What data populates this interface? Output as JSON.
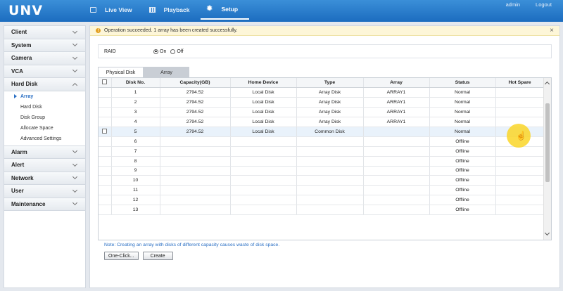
{
  "app": {
    "logo": "UNV",
    "nav": [
      {
        "label": "Live View",
        "icon": "monitor-icon",
        "active": false
      },
      {
        "label": "Playback",
        "icon": "film-icon",
        "active": false
      },
      {
        "label": "Setup",
        "icon": "gear-icon",
        "active": true
      }
    ],
    "user": "admin",
    "logout": "Logout"
  },
  "sidebar": {
    "sections": [
      {
        "label": "Client"
      },
      {
        "label": "System"
      },
      {
        "label": "Camera"
      },
      {
        "label": "VCA"
      },
      {
        "label": "Hard Disk",
        "expanded": true,
        "items": [
          "Array",
          "Hard Disk",
          "Disk Group",
          "Allocate Space",
          "Advanced Settings"
        ],
        "active_item": "Array"
      },
      {
        "label": "Alarm"
      },
      {
        "label": "Alert"
      },
      {
        "label": "Network"
      },
      {
        "label": "User"
      },
      {
        "label": "Maintenance"
      }
    ]
  },
  "banner": {
    "message": "Operation succeeded. 1 array has been created successfully.",
    "close": "×"
  },
  "raid": {
    "label": "RAID",
    "on": "On",
    "off": "Off",
    "selected": "On"
  },
  "tabs": [
    {
      "label": "Physical Disk",
      "active": true
    },
    {
      "label": "Array",
      "active": false
    }
  ],
  "table": {
    "headers": [
      "",
      "Disk No.",
      "Capacity(GB)",
      "Home Device",
      "Type",
      "Array",
      "Status",
      "Hot Spare"
    ],
    "rows": [
      {
        "checkbox": false,
        "disk_no": "1",
        "capacity": "2794.52",
        "home_device": "Local Disk",
        "type": "Array Disk",
        "array": "ARRAY1",
        "status": "Normal",
        "hot_spare": ""
      },
      {
        "checkbox": false,
        "disk_no": "2",
        "capacity": "2794.52",
        "home_device": "Local Disk",
        "type": "Array Disk",
        "array": "ARRAY1",
        "status": "Normal",
        "hot_spare": ""
      },
      {
        "checkbox": false,
        "disk_no": "3",
        "capacity": "2794.52",
        "home_device": "Local Disk",
        "type": "Array Disk",
        "array": "ARRAY1",
        "status": "Normal",
        "hot_spare": ""
      },
      {
        "checkbox": false,
        "disk_no": "4",
        "capacity": "2794.52",
        "home_device": "Local Disk",
        "type": "Array Disk",
        "array": "ARRAY1",
        "status": "Normal",
        "hot_spare": ""
      },
      {
        "checkbox": true,
        "disk_no": "5",
        "capacity": "2794.52",
        "home_device": "Local Disk",
        "type": "Common Disk",
        "array": "",
        "status": "Normal",
        "hot_spare": "",
        "highlight": true
      },
      {
        "checkbox": false,
        "disk_no": "6",
        "capacity": "",
        "home_device": "",
        "type": "",
        "array": "",
        "status": "Offline",
        "hot_spare": ""
      },
      {
        "checkbox": false,
        "disk_no": "7",
        "capacity": "",
        "home_device": "",
        "type": "",
        "array": "",
        "status": "Offline",
        "hot_spare": ""
      },
      {
        "checkbox": false,
        "disk_no": "8",
        "capacity": "",
        "home_device": "",
        "type": "",
        "array": "",
        "status": "Offline",
        "hot_spare": ""
      },
      {
        "checkbox": false,
        "disk_no": "9",
        "capacity": "",
        "home_device": "",
        "type": "",
        "array": "",
        "status": "Offline",
        "hot_spare": ""
      },
      {
        "checkbox": false,
        "disk_no": "10",
        "capacity": "",
        "home_device": "",
        "type": "",
        "array": "",
        "status": "Offline",
        "hot_spare": ""
      },
      {
        "checkbox": false,
        "disk_no": "11",
        "capacity": "",
        "home_device": "",
        "type": "",
        "array": "",
        "status": "Offline",
        "hot_spare": ""
      },
      {
        "checkbox": false,
        "disk_no": "12",
        "capacity": "",
        "home_device": "",
        "type": "",
        "array": "",
        "status": "Offline",
        "hot_spare": ""
      },
      {
        "checkbox": false,
        "disk_no": "13",
        "capacity": "",
        "home_device": "",
        "type": "",
        "array": "",
        "status": "Offline",
        "hot_spare": ""
      }
    ]
  },
  "note": "Note: Creating an array with disks of different capacity causes waste of disk space.",
  "buttons": {
    "one_click": "One-Click...",
    "create": "Create"
  },
  "colors": {
    "header_blue": "#1c6cbf",
    "link_blue": "#2a6fc4",
    "banner_bg": "#fdf6d8",
    "cursor_highlight": "#fad628"
  }
}
